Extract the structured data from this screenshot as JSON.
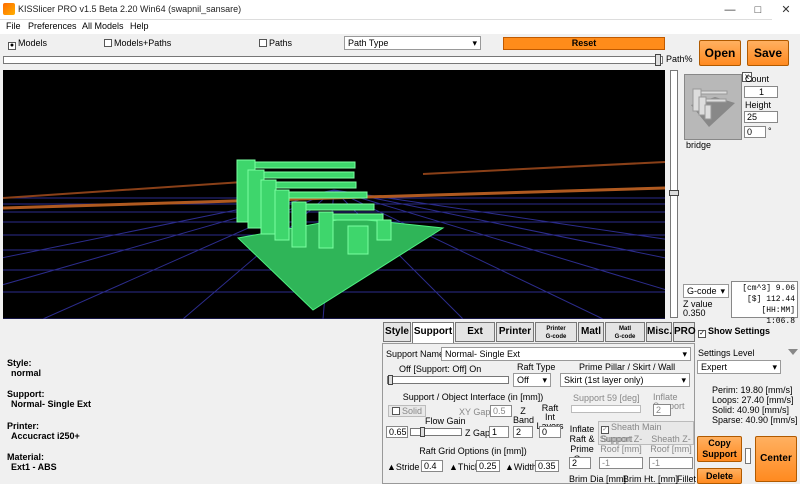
{
  "window": {
    "title": "KISSlicer PRO v1.5 Beta 2.20 Win64 (swapnil_sansare)",
    "minimize": "—",
    "maximize": "□",
    "close": "✕"
  },
  "menu": [
    "File",
    "Preferences",
    "All Models",
    "Help"
  ],
  "view_options": {
    "models_label": "Models",
    "models_checked": true,
    "models_paths_label": "Models+Paths",
    "models_paths_checked": false,
    "paths_label": "Paths",
    "paths_checked": false,
    "path_type_value": "Path Type"
  },
  "reset_label": "Reset",
  "path_slider_label": "Path%",
  "path_slider_value": 0.99,
  "open_label": "Open",
  "save_label": "Save",
  "model": {
    "name": "bridge",
    "count_label": "Count",
    "count_value": "1",
    "height_label": "Height",
    "height_value": "25",
    "rotate_value": "0",
    "degree_symbol": "°"
  },
  "gcode_select": "G-code",
  "z_value_label": "Z value",
  "z_value": "0.350",
  "stats": {
    "volume": "[cm^3] 9.06",
    "cost": "[$] 112.44",
    "time": "[HH:MM] 1:06.8"
  },
  "info": {
    "style_label": "Style:",
    "style_value": "normal",
    "support_label": "Support:",
    "support_value": "Normal- Single Ext",
    "printer_label": "Printer:",
    "printer_value": "Accucract i250+",
    "material_label": "Material:",
    "material_value": "Ext1 - ABS"
  },
  "tabs": {
    "style": "Style",
    "support": "Support",
    "extmap": "Ext Map",
    "printer": "Printer",
    "printer_gcode_top": "Printer",
    "printer_gcode_bottom": "G-code",
    "matl": "Matl",
    "matl_gcode_top": "Matl",
    "matl_gcode_bottom": "G-code",
    "misc": "Misc.",
    "pro": "PRO"
  },
  "support": {
    "support_name_label": "Support Name",
    "support_name_value": "Normal- Single Ext",
    "support_off_label": "Off [Support: Off] On",
    "raft_type_label": "Raft Type",
    "raft_type_value": "Off",
    "prime_pillar_label": "Prime Pillar / Skirt / Wall",
    "prime_pillar_value": "Skirt (1st layer only)",
    "interface_title": "Support / Object Interface (in [mm])",
    "solid_label": "Solid",
    "xy_gap_label": "XY Gap",
    "xy_gap_value": "0.5",
    "raft_int_layers_label": "Raft Int Layers",
    "raft_int_layers_value": "0",
    "flow_gain_label": "Flow Gain",
    "flow_gain_value": "0.65",
    "z_gap_label": "Z Gap",
    "z_gap_value": "1",
    "z_band_label": "Z Band",
    "z_band_value": "2",
    "support_deg_label": "Support 59 [deg]",
    "inflate_support_label": "Inflate Support",
    "inflate_support_value": "2",
    "inflate_raft_label": "Inflate Raft & Prime Gap",
    "inflate_raft_value": "2",
    "sheath_label": "Sheath Main Support",
    "support_zroof_label": "Support Z-Roof [mm]",
    "support_zroof_value": "-1",
    "sheath_zroof_label": "Sheath Z-Roof [mm]",
    "sheath_zroof_value": "-1",
    "raft_grid_title": "Raft Grid Options (in [mm])",
    "stride_label": "Stride",
    "stride_value": "0.4",
    "thick_label": "Thick",
    "thick_value": "0.25",
    "width_label": "Width",
    "width_value": "0.35",
    "brim_dia_label": "Brim Dia [mm]",
    "brim_ht_label": "Brim Ht. [mm]",
    "fillet_label": "Fillet"
  },
  "settings": {
    "show_settings_label": "Show Settings",
    "level_label": "Settings Level",
    "level_value": "Expert",
    "perim": "Perim:  19.80 [mm/s]",
    "loops": "Loops:  27.40 [mm/s]",
    "solid": "Solid:  40.90 [mm/s]",
    "sparse": "Sparse:  40.90 [mm/s]"
  },
  "copy_support_label": "Copy Support",
  "delete_label": "Delete",
  "center_label": "Center",
  "colors": {
    "accent": "#ff8c1a",
    "model": "#3dd46a",
    "grid": "#3a3aa8",
    "bed": "#a05020"
  }
}
